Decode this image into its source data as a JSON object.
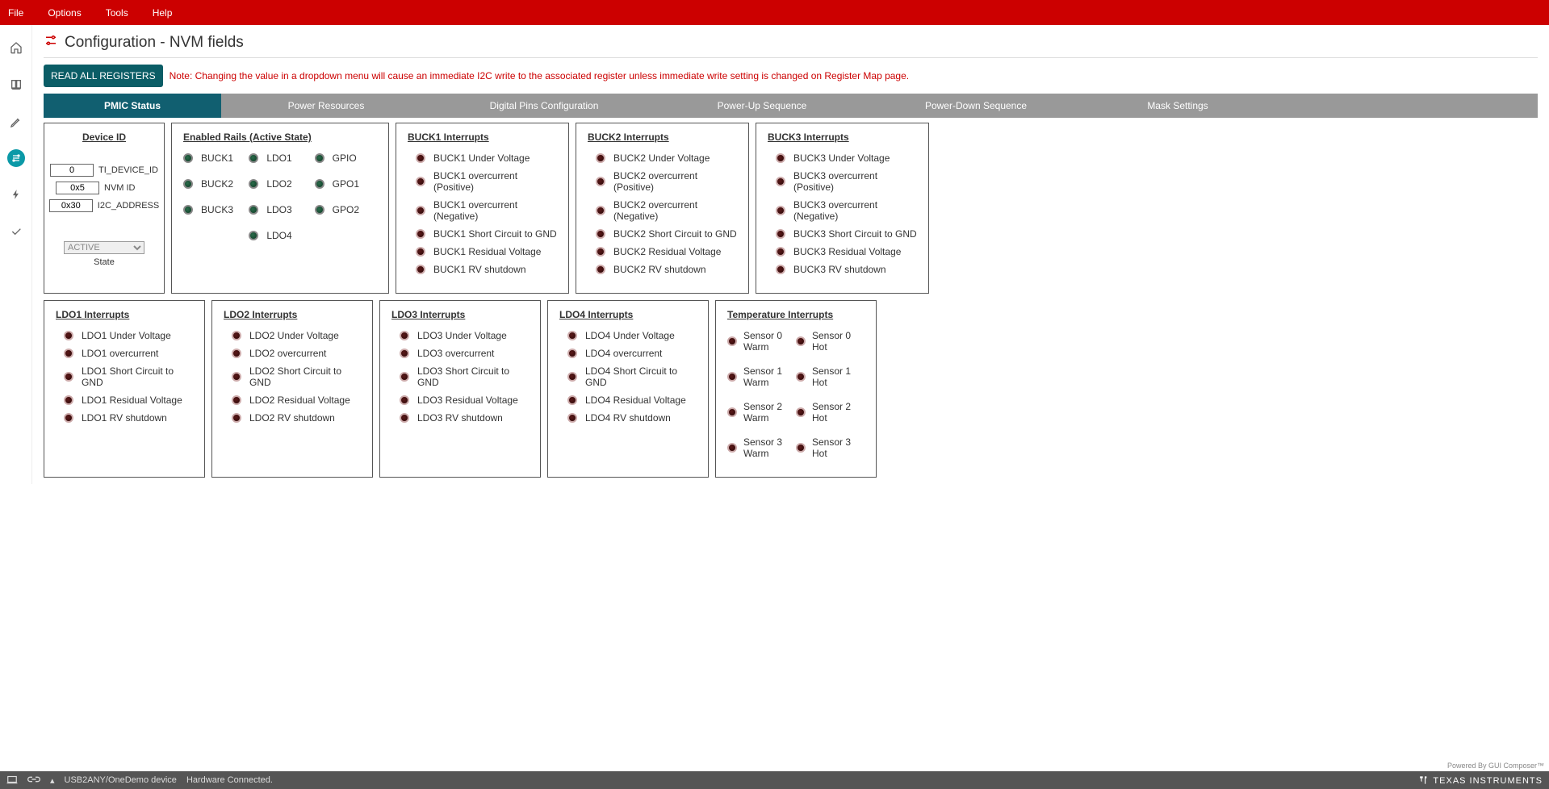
{
  "menu": {
    "file": "File",
    "options": "Options",
    "tools": "Tools",
    "help": "Help"
  },
  "page": {
    "title": "Configuration - NVM fields"
  },
  "actions": {
    "read_all": "READ ALL REGISTERS",
    "note": "Note: Changing the value in a dropdown menu will cause an immediate I2C write to the associated register unless immediate write setting is changed on Register Map page."
  },
  "tabs": {
    "t0": "PMIC Status",
    "t1": "Power Resources",
    "t2": "Digital Pins Configuration",
    "t3": "Power-Up Sequence",
    "t4": "Power-Down Sequence",
    "t5": "Mask Settings"
  },
  "device": {
    "title": "Device ID",
    "ti_device_val": "0",
    "ti_device_lbl": "TI_DEVICE_ID",
    "nvm_id_val": "0x5",
    "nvm_id_lbl": "NVM ID",
    "i2c_addr_val": "0x30",
    "i2c_addr_lbl": "I2C_ADDRESS",
    "state_val": "ACTIVE",
    "state_lbl": "State"
  },
  "enabled": {
    "title": "Enabled Rails (Active State)",
    "items": [
      "BUCK1",
      "LDO1",
      "GPIO",
      "BUCK2",
      "LDO2",
      "GPO1",
      "BUCK3",
      "LDO3",
      "GPO2",
      "",
      "LDO4",
      ""
    ]
  },
  "buck_int": {
    "b1": {
      "title": "BUCK1 Interrupts",
      "items": [
        "BUCK1 Under Voltage",
        "BUCK1 overcurrent (Positive)",
        "BUCK1 overcurrent (Negative)",
        "BUCK1 Short Circuit to GND",
        "BUCK1 Residual Voltage",
        "BUCK1 RV shutdown"
      ]
    },
    "b2": {
      "title": "BUCK2 Interrupts",
      "items": [
        "BUCK2 Under Voltage",
        "BUCK2 overcurrent (Positive)",
        "BUCK2 overcurrent (Negative)",
        "BUCK2 Short Circuit to GND",
        "BUCK2 Residual Voltage",
        "BUCK2 RV shutdown"
      ]
    },
    "b3": {
      "title": "BUCK3 Interrupts",
      "items": [
        "BUCK3 Under Voltage",
        "BUCK3 overcurrent (Positive)",
        "BUCK3 overcurrent (Negative)",
        "BUCK3 Short Circuit to GND",
        "BUCK3 Residual Voltage",
        "BUCK3 RV shutdown"
      ]
    }
  },
  "ldo_int": {
    "l1": {
      "title": "LDO1 Interrupts",
      "items": [
        "LDO1 Under Voltage",
        "LDO1 overcurrent",
        "LDO1 Short Circuit to GND",
        "LDO1 Residual Voltage",
        "LDO1 RV shutdown"
      ]
    },
    "l2": {
      "title": "LDO2 Interrupts",
      "items": [
        "LDO2 Under Voltage",
        "LDO2 overcurrent",
        "LDO2 Short Circuit to GND",
        "LDO2 Residual Voltage",
        "LDO2 RV shutdown"
      ]
    },
    "l3": {
      "title": "LDO3 Interrupts",
      "items": [
        "LDO3 Under Voltage",
        "LDO3 overcurrent",
        "LDO3 Short Circuit to GND",
        "LDO3 Residual Voltage",
        "LDO3 RV shutdown"
      ]
    },
    "l4": {
      "title": "LDO4 Interrupts",
      "items": [
        "LDO4 Under Voltage",
        "LDO4 overcurrent",
        "LDO4 Short Circuit to GND",
        "LDO4 Residual Voltage",
        "LDO4 RV shutdown"
      ]
    }
  },
  "temp": {
    "title": "Temperature Interrupts",
    "warm": [
      "Sensor 0 Warm",
      "Sensor 1 Warm",
      "Sensor 2 Warm",
      "Sensor 3 Warm"
    ],
    "hot": [
      "Sensor 0 Hot",
      "Sensor 1 Hot",
      "Sensor 2 Hot",
      "Sensor 3 Hot"
    ]
  },
  "footer": {
    "device": "USB2ANY/OneDemo device",
    "status": "Hardware Connected.",
    "logo": "TEXAS INSTRUMENTS",
    "credit": "Powered By GUI Composer™"
  }
}
